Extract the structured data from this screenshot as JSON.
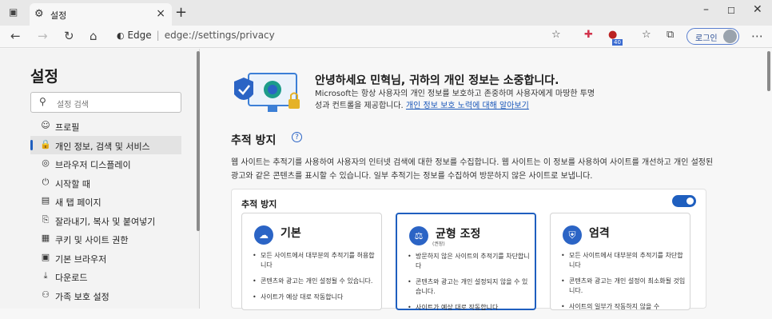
{
  "browser": {
    "tab_title": "설정",
    "address_brand": "Edge",
    "address_url": "edge://settings/privacy",
    "login_label": "로그인",
    "ext_badge_count": "40"
  },
  "sidebar": {
    "title": "설정",
    "search_placeholder": "설정 검색",
    "items": [
      {
        "label": "프로필",
        "icon": "profile-icon"
      },
      {
        "label": "개인 정보, 검색 및 서비스",
        "icon": "lock-icon",
        "active": true
      },
      {
        "label": "브라우저 디스플레이",
        "icon": "appearance-icon"
      },
      {
        "label": "시작할 때",
        "icon": "power-icon"
      },
      {
        "label": "새 탭 페이지",
        "icon": "newtab-icon"
      },
      {
        "label": "잘라내기, 복사 및 붙여넣기",
        "icon": "clipboard-icon"
      },
      {
        "label": "쿠키 및 사이트 권한",
        "icon": "cookie-icon"
      },
      {
        "label": "기본 브라우저",
        "icon": "browser-icon"
      },
      {
        "label": "다운로드",
        "icon": "download-icon"
      },
      {
        "label": "가족 보호 설정",
        "icon": "family-icon"
      }
    ]
  },
  "hero": {
    "title": "안녕하세요 민혁님, 귀하의 개인 정보는 소중합니다.",
    "desc": "Microsoft는 항상 사용자의 개인 정보를 보호하고 존중하며 사용자에게 마땅한 투명성과 컨트롤을 제공합니다.",
    "desc_line1": "Microsoft는 항상 사용자의 개인 정보를 보호하고 존중하며 사용자에게 마땅한 투명",
    "desc_line2": "성과 컨트롤을 제공합니다.",
    "link": "개인 정보 보호 노력에 대해 알아보기"
  },
  "tracking": {
    "section_title": "추적 방지",
    "desc": "웹 사이트는 추적기를 사용하여 사용자의 인터넷 검색에 대한 정보를 수집합니다. 웹 사이트는 이 정보를 사용하여 사이트를 개선하고 개인 설정된 광고와 같은 콘텐츠를 표시할 수 있습니다. 일부 추적기는 정보를 수집하여 방문하지 않은 사이트로 보냅니다.",
    "card_title": "추적 방지",
    "toggle_on": true,
    "levels": [
      {
        "name": "기본",
        "sub": "",
        "icon": "basic-icon",
        "bullets": [
          "모든 사이트에서 대부분의 추적기를 허용합니다",
          "콘텐츠와 광고는 개인 설정될 수 있습니다.",
          "사이트가 예상 대로 작동합니다"
        ]
      },
      {
        "name": "균형 조정",
        "sub": "(권장)",
        "icon": "balanced-icon",
        "selected": true,
        "bullets": [
          "방문하지 않은 사이트의 추적기를 차단합니다",
          "콘텐츠와 광고는 개인 설정되지 않을 수 있습니다.",
          "사이트가 예상 대로 작동합니다"
        ]
      },
      {
        "name": "엄격",
        "sub": "",
        "icon": "strict-icon",
        "bullets": [
          "모든 사이트에서 대부분의 추적기를 차단합니다",
          "콘텐츠와 광고는 개인 설정이 최소화될 것입니다.",
          "사이트의 일부가 작동하지 않을 수"
        ]
      }
    ]
  },
  "colors": {
    "accent": "#1f5fbf",
    "sidebar_bg": "#f3f3f3",
    "page_bg": "#f7f7f7"
  }
}
